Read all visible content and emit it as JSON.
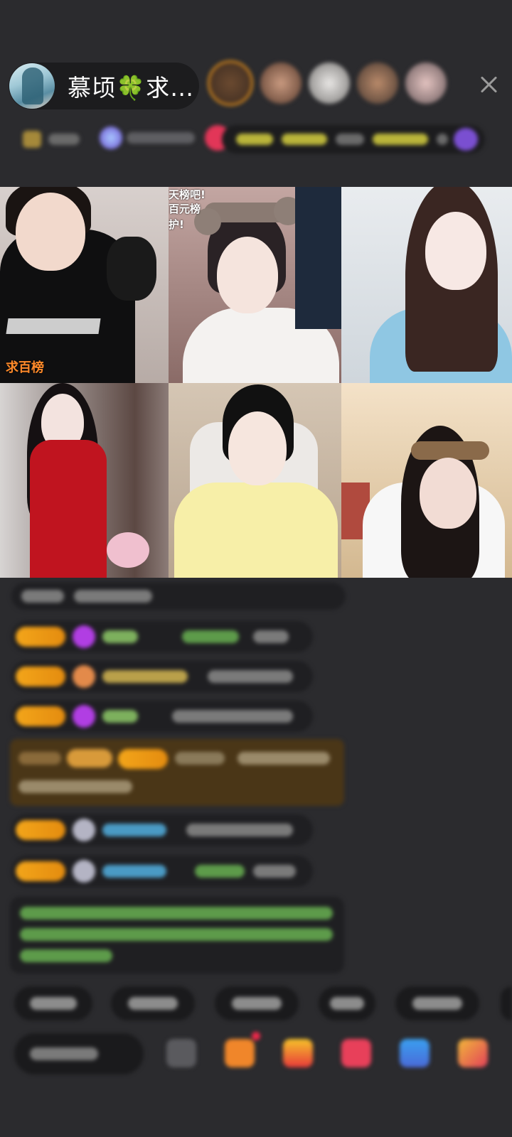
{
  "host": {
    "name": "慕顷🍀求…"
  },
  "colors": {
    "background": "#2b2b2e",
    "badge": "#f3a51a",
    "accent_orange": "#ff8a2a",
    "panel": "#1c1c1e"
  },
  "overlays": {
    "cell1_rank": "求百榜",
    "cell2_banner_1": "天榜吧!",
    "cell2_banner_2": "百元榜",
    "cell2_banner_3": "护!"
  },
  "icons": {
    "close": "close-icon",
    "emoji": "emoji-icon",
    "gift": "gift-icon"
  }
}
